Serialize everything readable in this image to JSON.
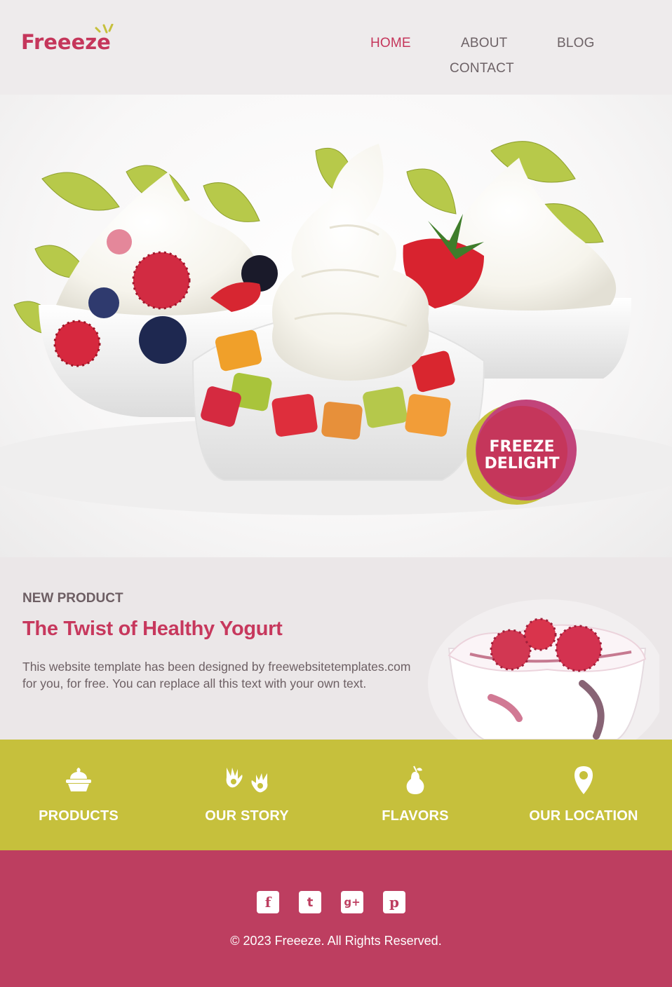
{
  "header": {
    "logo_text": "Freeeze",
    "nav": [
      {
        "label": "HOME",
        "active": true
      },
      {
        "label": "ABOUT",
        "active": false
      },
      {
        "label": "BLOG",
        "active": false
      },
      {
        "label": "CONTACT",
        "active": false
      }
    ]
  },
  "hero": {
    "badge_line1": "FREEZE",
    "badge_line2": "DELIGHT"
  },
  "product": {
    "label": "NEW PRODUCT",
    "title": "The Twist of Healthy Yogurt",
    "text": "This website template has been designed by freewebsitetemplates.com for you, for free. You can replace all this text with your own text."
  },
  "features": [
    {
      "label": "PRODUCTS",
      "icon": "cupcake-icon"
    },
    {
      "label": "OUR STORY",
      "icon": "hands-icon"
    },
    {
      "label": "FLAVORS",
      "icon": "pear-icon"
    },
    {
      "label": "OUR LOCATION",
      "icon": "location-pin-icon"
    }
  ],
  "footer": {
    "social": [
      {
        "name": "facebook-icon",
        "glyph": "f"
      },
      {
        "name": "twitter-icon",
        "glyph": "t"
      },
      {
        "name": "google-plus-icon",
        "glyph": "g+"
      },
      {
        "name": "pinterest-icon",
        "glyph": "p"
      }
    ],
    "copyright": "© 2023 Freeeze. All Rights Reserved."
  },
  "colors": {
    "brand_pink": "#c5365b",
    "brand_green": "#c6c03c",
    "footer_pink": "#bd3e60",
    "header_bg": "#eeebec"
  }
}
